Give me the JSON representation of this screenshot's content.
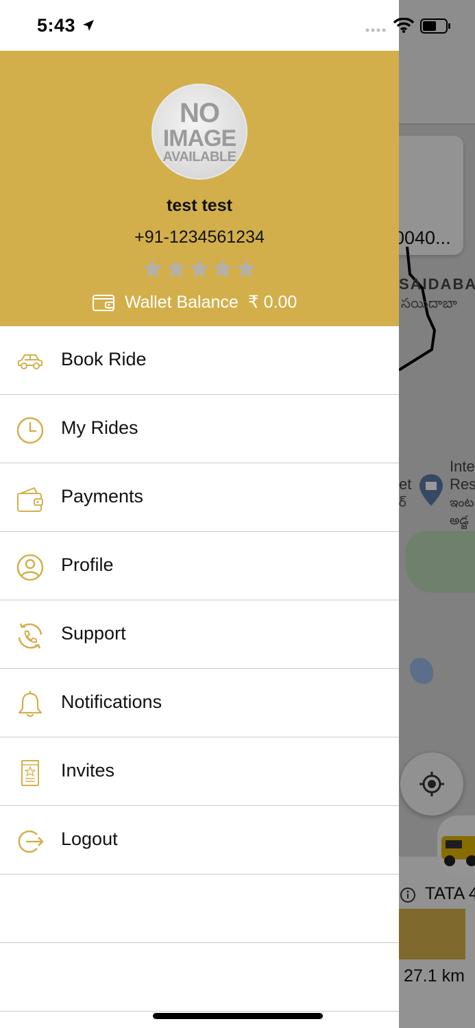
{
  "status_bar": {
    "time": "5:43"
  },
  "profile": {
    "avatar_text": [
      "NO",
      "IMAGE",
      "AVAILABLE"
    ],
    "name": "test test",
    "phone": "+91-1234561234",
    "rating": 0,
    "rating_max": 5,
    "wallet_label": "Wallet Balance",
    "wallet_amount": "₹ 0.00"
  },
  "menu": [
    {
      "label": "Book Ride",
      "icon": "car-icon"
    },
    {
      "label": "My Rides",
      "icon": "clock-icon"
    },
    {
      "label": "Payments",
      "icon": "wallet-icon"
    },
    {
      "label": "Profile",
      "icon": "user-icon"
    },
    {
      "label": "Support",
      "icon": "phone-support-icon"
    },
    {
      "label": "Notifications",
      "icon": "bell-icon"
    },
    {
      "label": "Invites",
      "icon": "invite-card-icon"
    },
    {
      "label": "Logout",
      "icon": "logout-icon"
    }
  ],
  "background_map": {
    "card_text": "0040...",
    "area_label": "SAIDABA",
    "area_label_telugu": "సయిదాబా",
    "poi_text": [
      "Inte",
      "Res",
      "ఇంట",
      "అడ్జ"
    ],
    "poi_left_text": [
      "et",
      "ర్"
    ],
    "vehicle_name": "TATA 4",
    "distance": "27.1 km"
  },
  "colors": {
    "brand_gold": "#d3af4b",
    "icon_gold": "#d3af4b",
    "divider": "#c9c9c9"
  }
}
